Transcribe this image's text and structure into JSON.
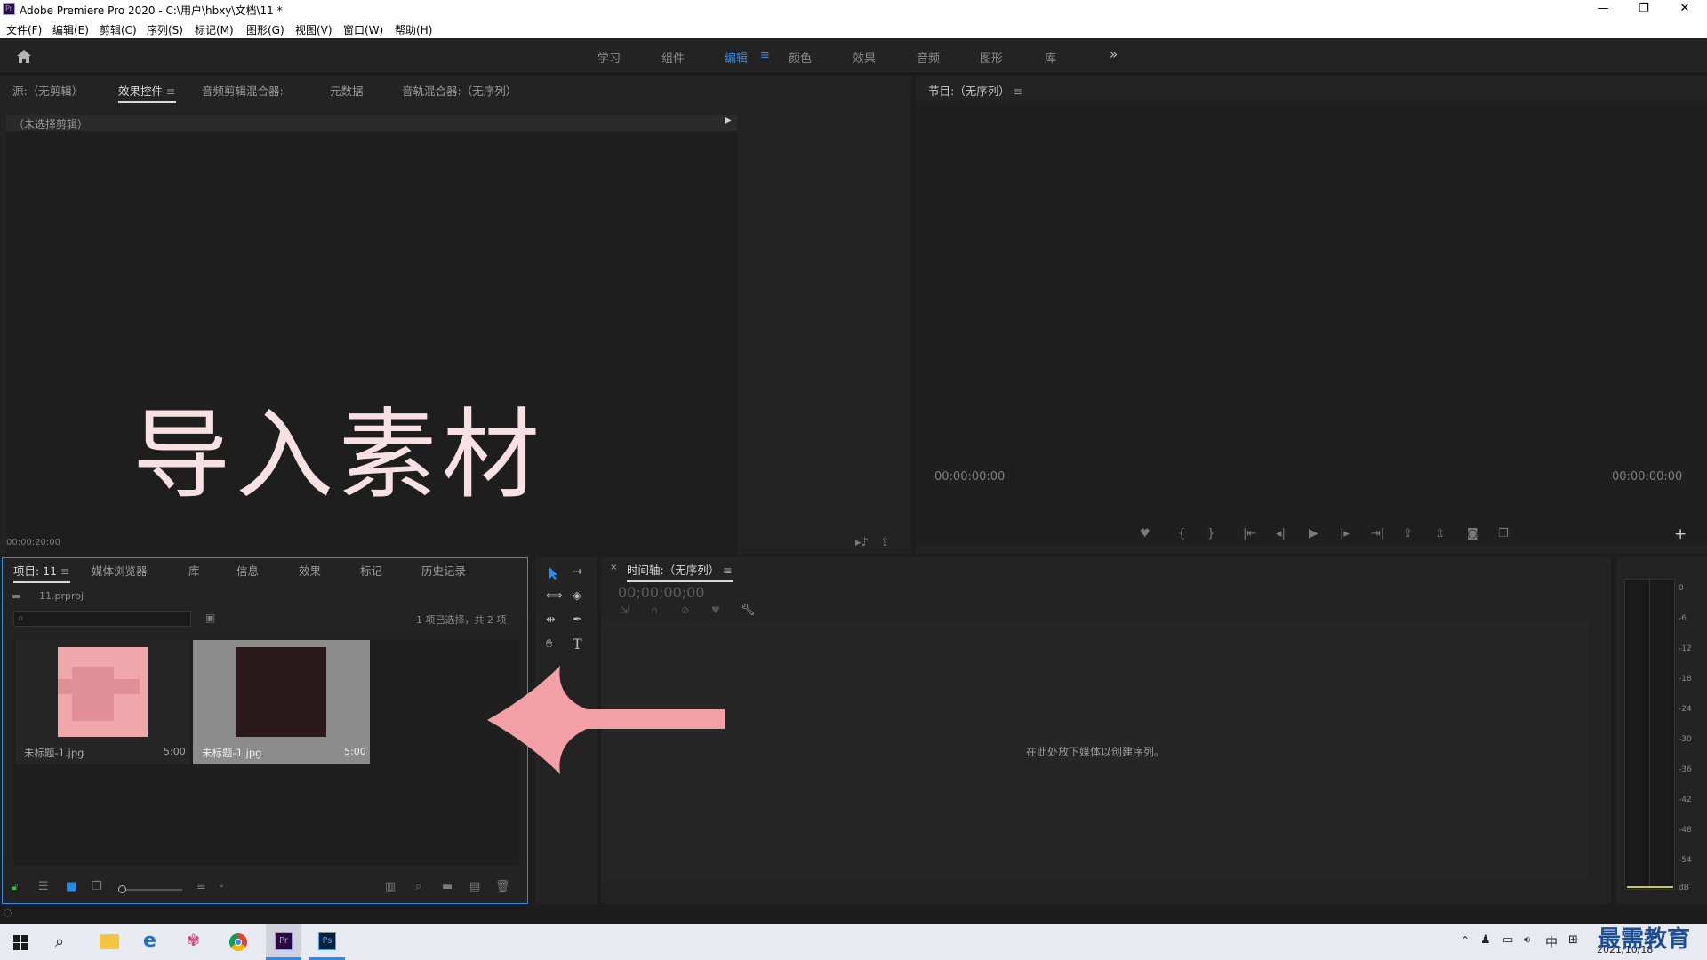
{
  "titlebar": {
    "title": "Adobe Premiere Pro 2020 - C:\\用户\\hbxy\\文档\\11 *",
    "logo": "Pr"
  },
  "menu": [
    "文件(F)",
    "编辑(E)",
    "剪辑(C)",
    "序列(S)",
    "标记(M)",
    "图形(G)",
    "视图(V)",
    "窗口(W)",
    "帮助(H)"
  ],
  "workspaces": [
    "学习",
    "组件",
    "编辑",
    "颜色",
    "效果",
    "音频",
    "图形",
    "库"
  ],
  "active_workspace": "编辑",
  "source_tabs": [
    "源:（无剪辑）",
    "效果控件",
    "音频剪辑混合器:",
    "元数据",
    "音轨混合器:（无序列）"
  ],
  "effects": {
    "no_clip": "（未选择剪辑）",
    "timecode": "00:00:20:00"
  },
  "overlay_text": "导入素材",
  "program": {
    "title": "节目:（无序列）",
    "tc_left": "00:00:00:00",
    "tc_right": "00:00:00:00"
  },
  "project_tabs": [
    "项目: 11",
    "媒体浏览器",
    "库",
    "信息",
    "效果",
    "标记",
    "历史记录"
  ],
  "project": {
    "file": "11.prproj",
    "selection": "1 项已选择，共 2 项",
    "items": [
      {
        "name": "未标题-1.jpg",
        "duration": "5:00"
      },
      {
        "name": "未标题-1.jpg",
        "duration": "5:00"
      }
    ]
  },
  "timeline": {
    "title": "时间轴:（无序列）",
    "timecode": "00;00;00;00",
    "drop_hint": "在此处放下媒体以创建序列。"
  },
  "meter": {
    "labels": [
      "0",
      "-6",
      "-12",
      "-18",
      "-24",
      "-30",
      "-36",
      "-42",
      "-48",
      "-54",
      "dB"
    ]
  },
  "taskbar": {
    "date": "2021/10/18",
    "ime": "中",
    "watermark": "最需教育"
  },
  "colors": {
    "accent": "#2d8ceb",
    "panel": "#232323",
    "arrow": "#f2a0a6",
    "overlay_text": "#f9e0e2"
  }
}
